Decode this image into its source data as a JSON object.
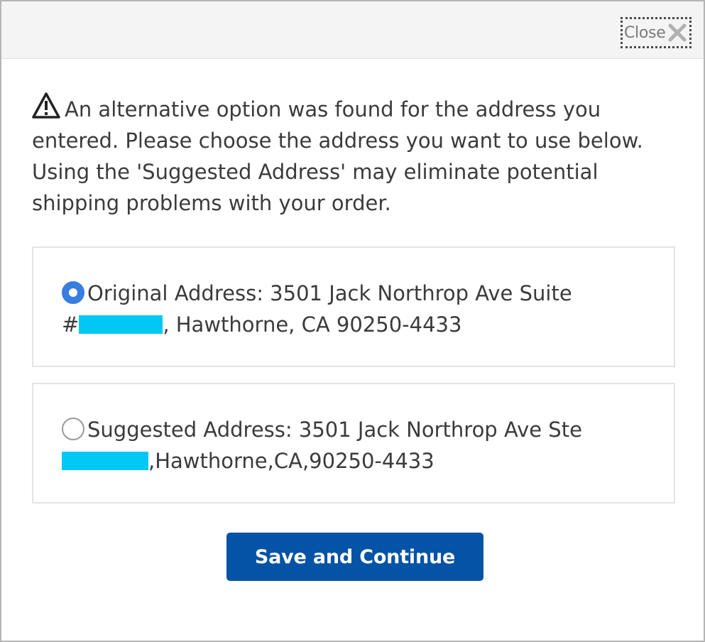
{
  "dialog": {
    "close_label": "Close",
    "message": "An alternative option was found for the address you entered. Please choose the address you want to use below. Using the 'Suggested Address' may eliminate potential shipping problems with your order.",
    "options": [
      {
        "label_line1": "Original Address: 3501 Jack Northrop Ave Suite",
        "line2_prefix": "#",
        "line2_suffix": ", Hawthorne, CA 90250-4433",
        "selected": true
      },
      {
        "label_line1": "Suggested Address: 3501 Jack Northrop Ave Ste",
        "line2_prefix": "",
        "line2_suffix": ",Hawthorne,CA,90250-4433",
        "selected": false
      }
    ],
    "save_label": "Save and Continue"
  },
  "colors": {
    "button_bg": "#0553a6",
    "radio_selected": "#3a7de0",
    "redaction": "#00c8f5",
    "titlebar_bg": "#f4f4f4"
  },
  "icons": {
    "close": "close-x-icon",
    "warning": "warning-triangle-icon"
  }
}
